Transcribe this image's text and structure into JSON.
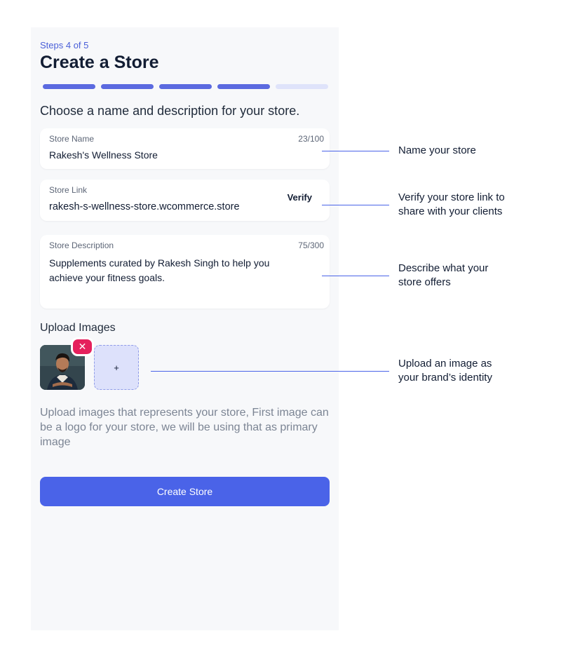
{
  "header": {
    "step_label": "Steps 4 of 5",
    "title": "Create a Store",
    "progress": {
      "current": 4,
      "total": 5
    },
    "colors": {
      "active": "#5b6ae0",
      "inactive": "#dfe3fa"
    }
  },
  "form": {
    "subtitle": "Choose a name and description for your store.",
    "store_name": {
      "label": "Store Name",
      "value": "Rakesh's Wellness Store",
      "count": "23/100"
    },
    "store_link": {
      "label": "Store Link",
      "value": "rakesh-s-wellness-store.wcommerce.store",
      "action": "Verify"
    },
    "store_description": {
      "label": "Store Description",
      "value": "Supplements curated by Rakesh Singh to help you achieve your fitness goals.",
      "count": "75/300"
    }
  },
  "uploads": {
    "title": "Upload Images",
    "remove_glyph": "✕",
    "add_glyph": "+",
    "hint": "Upload images that represents your store, First image can be a logo for your store, we will be using that as primary image"
  },
  "cta": {
    "label": "Create Store",
    "color": "#4a63e8"
  },
  "annotations": {
    "name": "Name your store",
    "link": "Verify your store link to share with your clients",
    "description": "Describe what your store offers",
    "image": "Upload an image as your brand’s identity"
  }
}
